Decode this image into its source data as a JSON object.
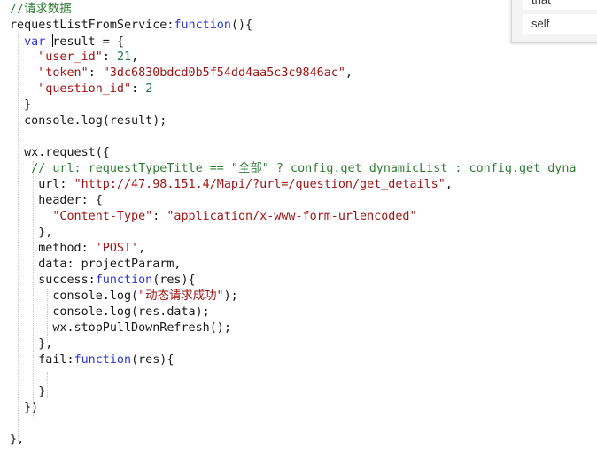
{
  "editor": {
    "lines": [
      [
        {
          "t": "comment",
          "v": "//请求数据"
        }
      ],
      [
        {
          "t": "plain",
          "v": "requestListFromService:"
        },
        {
          "t": "keyword",
          "v": "function"
        },
        {
          "t": "plain",
          "v": "(){"
        }
      ],
      [
        {
          "t": "plain",
          "v": "  "
        },
        {
          "t": "keyword",
          "v": "var"
        },
        {
          "t": "plain",
          "v": " "
        },
        {
          "t": "caret",
          "v": ""
        },
        {
          "t": "plain",
          "v": "result = {"
        }
      ],
      [
        {
          "t": "plain",
          "v": "    "
        },
        {
          "t": "string",
          "v": "\"user_id\""
        },
        {
          "t": "plain",
          "v": ": "
        },
        {
          "t": "number",
          "v": "21"
        },
        {
          "t": "plain",
          "v": ","
        }
      ],
      [
        {
          "t": "plain",
          "v": "    "
        },
        {
          "t": "string",
          "v": "\"token\""
        },
        {
          "t": "plain",
          "v": ": "
        },
        {
          "t": "string",
          "v": "\"3dc6830bdcd0b5f54dd4aa5c3c9846ac\""
        },
        {
          "t": "plain",
          "v": ","
        }
      ],
      [
        {
          "t": "plain",
          "v": "    "
        },
        {
          "t": "string",
          "v": "\"question_id\""
        },
        {
          "t": "plain",
          "v": ": "
        },
        {
          "t": "number",
          "v": "2"
        }
      ],
      [
        {
          "t": "plain",
          "v": "  }"
        }
      ],
      [
        {
          "t": "plain",
          "v": "  console.log(result);"
        }
      ],
      [
        {
          "t": "plain",
          "v": ""
        }
      ],
      [
        {
          "t": "plain",
          "v": "  wx.request({"
        }
      ],
      [
        {
          "t": "plain",
          "v": "   "
        },
        {
          "t": "comment",
          "v": "// url: requestTypeTitle == \"全部\" ? config.get_dynamicList : config.get_dyna"
        }
      ],
      [
        {
          "t": "plain",
          "v": "    url: "
        },
        {
          "t": "string",
          "v": "\""
        },
        {
          "t": "link",
          "v": "http://47.98.151.4/Mapi/?url=/question/get_details"
        },
        {
          "t": "string",
          "v": "\""
        },
        {
          "t": "plain",
          "v": ","
        }
      ],
      [
        {
          "t": "plain",
          "v": "    header: {"
        }
      ],
      [
        {
          "t": "plain",
          "v": "      "
        },
        {
          "t": "string",
          "v": "\"Content-Type\""
        },
        {
          "t": "plain",
          "v": ": "
        },
        {
          "t": "string",
          "v": "\"application/x-www-form-urlencoded\""
        }
      ],
      [
        {
          "t": "plain",
          "v": "    },"
        }
      ],
      [
        {
          "t": "plain",
          "v": "    method: "
        },
        {
          "t": "string",
          "v": "'POST'"
        },
        {
          "t": "plain",
          "v": ","
        }
      ],
      [
        {
          "t": "plain",
          "v": "    data: projectPararm,"
        }
      ],
      [
        {
          "t": "plain",
          "v": "    success:"
        },
        {
          "t": "keyword",
          "v": "function"
        },
        {
          "t": "plain",
          "v": "(res){"
        }
      ],
      [
        {
          "t": "plain",
          "v": "      console.log("
        },
        {
          "t": "string",
          "v": "\"动态请求成功\""
        },
        {
          "t": "plain",
          "v": ");"
        }
      ],
      [
        {
          "t": "plain",
          "v": "      console.log(res.data);"
        }
      ],
      [
        {
          "t": "plain",
          "v": "      wx.stopPullDownRefresh();"
        }
      ],
      [
        {
          "t": "plain",
          "v": "    },"
        }
      ],
      [
        {
          "t": "plain",
          "v": "    fail:"
        },
        {
          "t": "keyword",
          "v": "function"
        },
        {
          "t": "plain",
          "v": "(res){"
        }
      ],
      [
        {
          "t": "plain",
          "v": ""
        }
      ],
      [
        {
          "t": "plain",
          "v": "    }"
        }
      ],
      [
        {
          "t": "plain",
          "v": "  })"
        }
      ],
      [
        {
          "t": "plain",
          "v": ""
        }
      ],
      [
        {
          "t": "plain",
          "v": "},"
        }
      ]
    ]
  },
  "autocomplete": {
    "items": [
      "that",
      "self"
    ]
  }
}
